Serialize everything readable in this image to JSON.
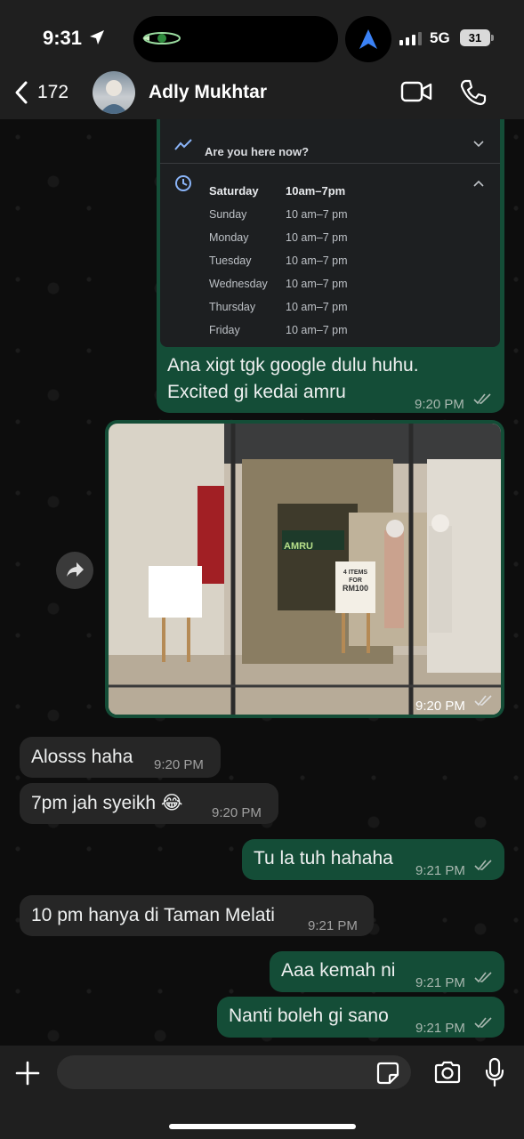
{
  "status_bar": {
    "time": "9:31",
    "network": "5G",
    "battery": "31"
  },
  "header": {
    "back_count": "172",
    "contact_name": "Adly Mukhtar"
  },
  "place_card": {
    "live_label": "Are you here now?",
    "hours": [
      {
        "day": "Saturday",
        "time": "10am–7pm"
      },
      {
        "day": "Sunday",
        "time": "10 am–7 pm"
      },
      {
        "day": "Monday",
        "time": "10 am–7 pm"
      },
      {
        "day": "Tuesday",
        "time": "10 am–7 pm"
      },
      {
        "day": "Wednesday",
        "time": "10 am–7 pm"
      },
      {
        "day": "Thursday",
        "time": "10 am–7 pm"
      },
      {
        "day": "Friday",
        "time": "10 am–7 pm"
      }
    ]
  },
  "messages": [
    {
      "text_line1": "Ana xigt tgk google dulu huhu.",
      "text_line2": "Excited gi kedai amru",
      "time": "9:20 PM"
    },
    {
      "time": "9:20 PM"
    },
    {
      "text": "Alosss haha",
      "time": "9:20 PM"
    },
    {
      "text": "7pm jah syeikh 😂",
      "time": "9:20 PM"
    },
    {
      "text": "Tu la tuh hahaha",
      "time": "9:21 PM"
    },
    {
      "text": "10 pm hanya di Taman Melati",
      "time": "9:21 PM"
    },
    {
      "text": "Aaa kemah ni",
      "time": "9:21 PM"
    },
    {
      "text": "Nanti boleh gi sano",
      "time": "9:21 PM"
    }
  ],
  "photo_signs": {
    "left_sign": "",
    "right_sign_line1": "4 ITEMS",
    "right_sign_line2": "FOR",
    "right_sign_line3": "RM100",
    "store_sign": "AMRU"
  },
  "input": {
    "placeholder": ""
  },
  "colors": {
    "outgoing_bubble": "#144d37",
    "incoming_bubble": "#262626",
    "background": "#0d0d0d"
  }
}
